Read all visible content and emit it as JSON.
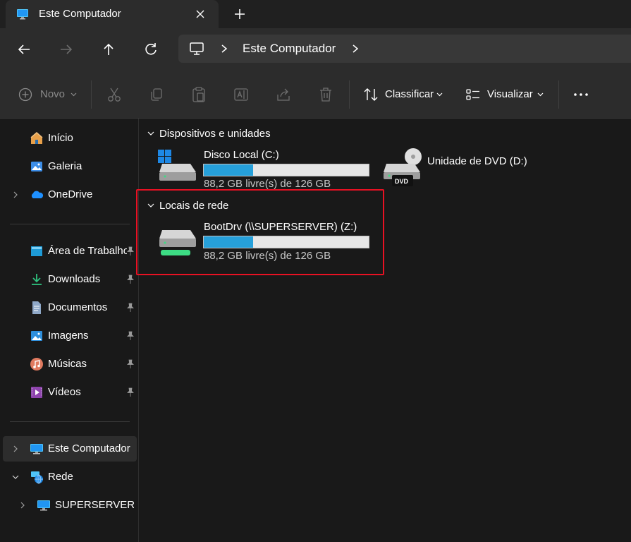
{
  "window": {
    "tab_title": "Este Computador",
    "tab_icon": "monitor-icon"
  },
  "address": {
    "crumb": "Este Computador"
  },
  "toolbar": {
    "new_label": "Novo",
    "sort_label": "Classificar",
    "view_label": "Visualizar",
    "icons": [
      "cut-icon",
      "copy-icon",
      "paste-icon",
      "rename-icon",
      "share-icon",
      "delete-icon",
      "more-icon"
    ]
  },
  "sidebar": {
    "items": [
      {
        "label": "Início",
        "icon": "home-icon"
      },
      {
        "label": "Galeria",
        "icon": "gallery-icon"
      },
      {
        "label": "OneDrive",
        "icon": "cloud-icon"
      },
      {
        "label": "Área de Trabalho",
        "icon": "desktop-icon"
      },
      {
        "label": "Downloads",
        "icon": "download-icon"
      },
      {
        "label": "Documentos",
        "icon": "document-icon"
      },
      {
        "label": "Imagens",
        "icon": "pictures-icon"
      },
      {
        "label": "Músicas",
        "icon": "music-icon"
      },
      {
        "label": "Vídeos",
        "icon": "videos-icon"
      },
      {
        "label": "Este Computador",
        "icon": "monitor-icon"
      },
      {
        "label": "Rede",
        "icon": "network-icon"
      },
      {
        "label": "SUPERSERVER",
        "icon": "monitor-icon"
      }
    ]
  },
  "content": {
    "devices_header": "Dispositivos e unidades",
    "network_header": "Locais de rede",
    "drives": [
      {
        "name": "Disco Local (C:)",
        "free_text": "88,2 GB livre(s) de 126 GB",
        "used_fraction": 0.3
      },
      {
        "name": "Unidade de DVD (D:)",
        "badge": "DVD"
      },
      {
        "name": "BootDrv (\\\\SUPERSERVER) (Z:)",
        "free_text": "88,2 GB livre(s) de 126 GB",
        "used_fraction": 0.3
      }
    ]
  },
  "colors": {
    "accent_bar": "#26a0da",
    "highlight": "#e81123"
  }
}
